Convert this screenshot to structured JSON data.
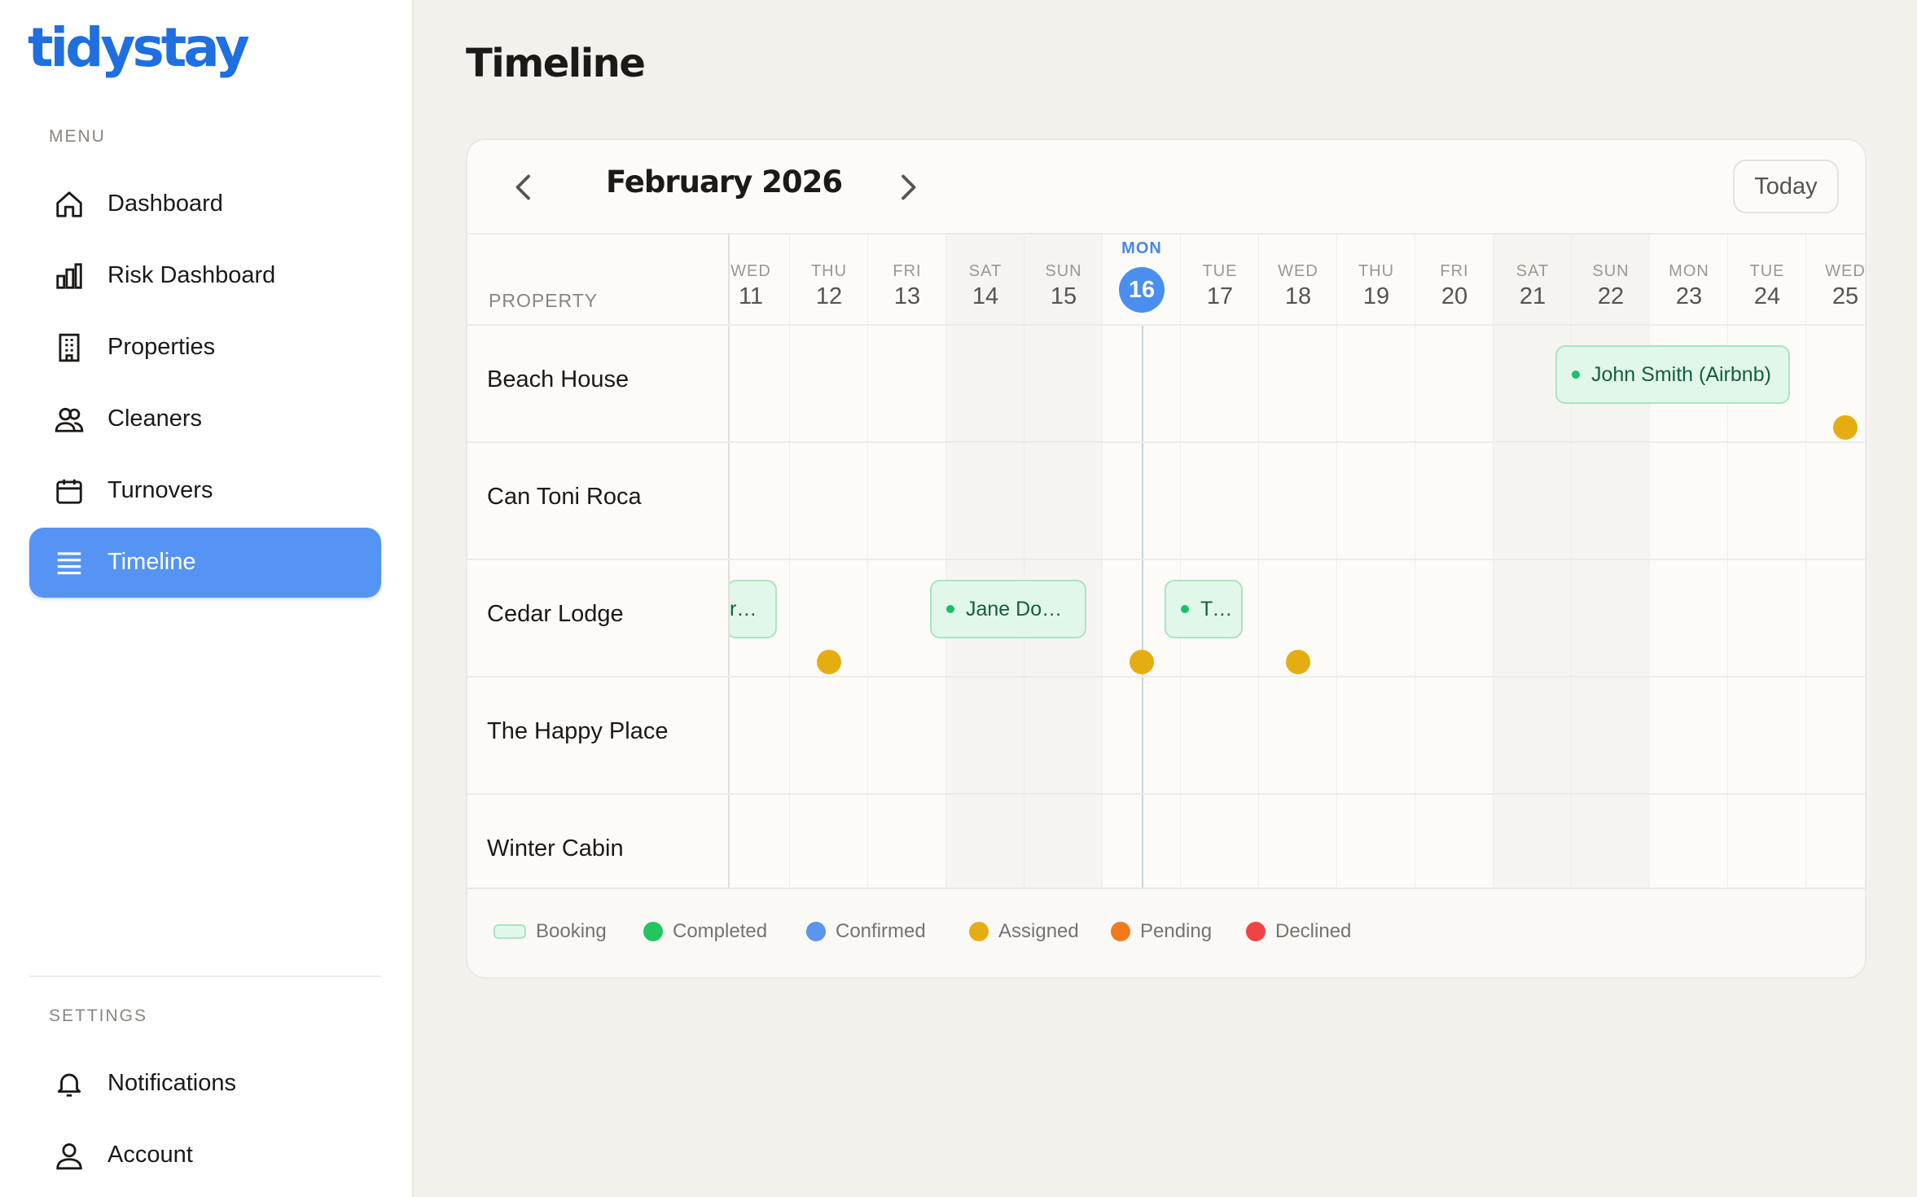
{
  "brand": {
    "name": "tidystay"
  },
  "sidebar": {
    "menu_label": "MENU",
    "items": [
      {
        "label": "Dashboard",
        "icon": "home-icon",
        "active": false
      },
      {
        "label": "Risk Dashboard",
        "icon": "bar-chart-icon",
        "active": false
      },
      {
        "label": "Properties",
        "icon": "building-icon",
        "active": false
      },
      {
        "label": "Cleaners",
        "icon": "users-icon",
        "active": false
      },
      {
        "label": "Turnovers",
        "icon": "calendar-icon",
        "active": false
      },
      {
        "label": "Timeline",
        "icon": "list-icon",
        "active": true
      }
    ],
    "settings_label": "SETTINGS",
    "settings_items": [
      {
        "label": "Notifications",
        "icon": "bell-icon"
      },
      {
        "label": "Account",
        "icon": "user-icon"
      }
    ]
  },
  "page": {
    "title": "Timeline"
  },
  "calendar": {
    "month_label": "February 2026",
    "today_button": "Today",
    "property_header": "PROPERTY",
    "days": [
      {
        "dow": "WED",
        "num": "11",
        "weekend": false
      },
      {
        "dow": "THU",
        "num": "12",
        "weekend": false
      },
      {
        "dow": "FRI",
        "num": "13",
        "weekend": false
      },
      {
        "dow": "SAT",
        "num": "14",
        "weekend": true
      },
      {
        "dow": "SUN",
        "num": "15",
        "weekend": true
      },
      {
        "dow": "MON",
        "num": "16",
        "weekend": false,
        "today": true
      },
      {
        "dow": "TUE",
        "num": "17",
        "weekend": false
      },
      {
        "dow": "WED",
        "num": "18",
        "weekend": false
      },
      {
        "dow": "THU",
        "num": "19",
        "weekend": false
      },
      {
        "dow": "FRI",
        "num": "20",
        "weekend": false
      },
      {
        "dow": "SAT",
        "num": "21",
        "weekend": true
      },
      {
        "dow": "SUN",
        "num": "22",
        "weekend": true
      },
      {
        "dow": "MON",
        "num": "23",
        "weekend": false
      },
      {
        "dow": "TUE",
        "num": "24",
        "weekend": false
      },
      {
        "dow": "WED",
        "num": "25",
        "weekend": false
      }
    ],
    "properties": [
      "Beach House",
      "Can Toni Roca",
      "Cedar Lodge",
      "The Happy Place",
      "Winter Cabin"
    ],
    "bookings": [
      {
        "property": "Beach House",
        "label": "John Smith (Airbnb)",
        "start_day": "21",
        "end_day": "24"
      },
      {
        "property": "Cedar Lodge",
        "label": "rbnb)",
        "start_day": "10",
        "end_day": "11",
        "clipped_left": true
      },
      {
        "property": "Cedar Lodge",
        "label": "Jane Doe (Airbnb) ...",
        "start_day": "13",
        "end_day": "15"
      },
      {
        "property": "Cedar Lodge",
        "label": "Tight Tur...",
        "start_day": "16",
        "end_day": "17"
      }
    ],
    "turnovers": [
      {
        "property": "Beach House",
        "day": "25",
        "status": "Assigned"
      },
      {
        "property": "Cedar Lodge",
        "day": "12",
        "status": "Assigned"
      },
      {
        "property": "Cedar Lodge",
        "day": "16",
        "status": "Assigned"
      },
      {
        "property": "Cedar Lodge",
        "day": "18",
        "status": "Assigned"
      }
    ]
  },
  "legend": [
    {
      "label": "Booking",
      "kind": "booking"
    },
    {
      "label": "Completed",
      "color": "#22c55e"
    },
    {
      "label": "Confirmed",
      "color": "#5b95ee"
    },
    {
      "label": "Assigned",
      "color": "#e6ad12"
    },
    {
      "label": "Pending",
      "color": "#f07a1e"
    },
    {
      "label": "Declined",
      "color": "#ef4444"
    }
  ],
  "colors": {
    "accent": "#5594f2",
    "brand": "#1f6fe0",
    "assigned": "#e6ad12",
    "booking_bg": "#e1f7ea"
  }
}
